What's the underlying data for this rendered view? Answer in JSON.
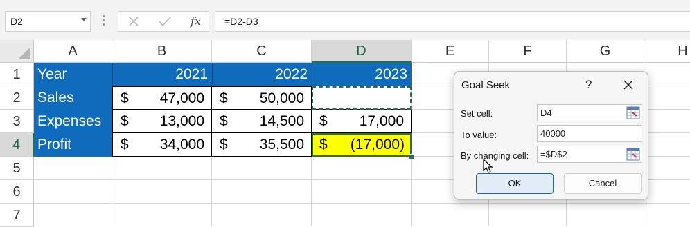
{
  "formula_bar": {
    "name_box": "D2",
    "fx_label": "fx",
    "formula": "=D2-D3"
  },
  "columns": [
    "A",
    "B",
    "C",
    "D",
    "E",
    "F",
    "G",
    "H"
  ],
  "rows": [
    "1",
    "2",
    "3",
    "4",
    "5",
    "6",
    "7"
  ],
  "sheet": {
    "header_row": {
      "label": "Year",
      "y2021": "2021",
      "y2022": "2022",
      "y2023": "2023"
    },
    "sales": {
      "label": "Sales",
      "b_cur": "$",
      "b": "47,000",
      "c_cur": "$",
      "c": "50,000",
      "d": ""
    },
    "expenses": {
      "label": "Expenses",
      "b_cur": "$",
      "b": "13,000",
      "c_cur": "$",
      "c": "14,500",
      "d_cur": "$",
      "d": "17,000"
    },
    "profit": {
      "label": "Profit",
      "b_cur": "$",
      "b": "34,000",
      "c_cur": "$",
      "c": "35,500",
      "d_cur": "$",
      "d": "(17,000)"
    }
  },
  "dialog": {
    "title": "Goal Seek",
    "help": "?",
    "set_cell_label": "Set cell:",
    "set_cell_value": "D4",
    "to_value_label": "To value:",
    "to_value_value": "40000",
    "by_changing_label": "By changing cell:",
    "by_changing_value": "=$D$2",
    "ok_label": "OK",
    "cancel_label": "Cancel"
  },
  "colors": {
    "header_fill": "#0f6cbd",
    "highlight": "#ffff00",
    "excel_green": "#217346"
  }
}
